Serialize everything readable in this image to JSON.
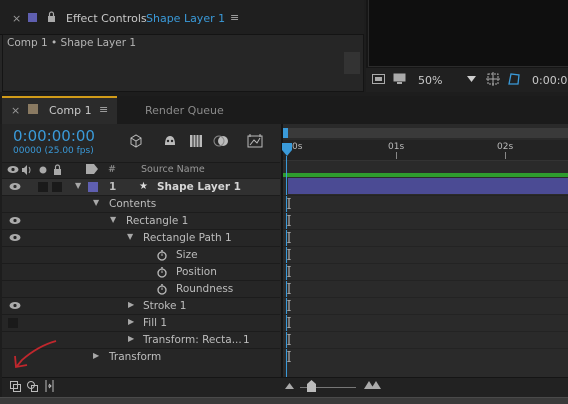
{
  "effect_controls": {
    "close": "×",
    "title": "Effect Controls",
    "layer_name": "Shape Layer 1",
    "menu": "≡",
    "breadcrumb": "Comp 1 • Shape Layer 1"
  },
  "viewer": {
    "zoom": "50%",
    "timecode": "0:00:00:"
  },
  "comp_tabs": {
    "close": "×",
    "active_label": "Comp 1",
    "menu": "≡",
    "inactive_label": "Render Queue"
  },
  "comp": {
    "timecode": "0:00:00:00",
    "frame_info": "00000 (25.00 fps)",
    "col_hash": "#",
    "col_source": "Source Name"
  },
  "ruler": {
    "ticks": [
      "0s",
      "01s",
      "02s"
    ]
  },
  "layers": [
    {
      "num": "1",
      "star": "★",
      "name": "Shape Layer 1"
    },
    {
      "name": "Contents"
    },
    {
      "name": "Rectangle 1"
    },
    {
      "name": "Rectangle Path 1"
    },
    {
      "name": "Size"
    },
    {
      "name": "Position"
    },
    {
      "name": "Roundness"
    },
    {
      "name": "Stroke 1"
    },
    {
      "name": "Fill 1"
    },
    {
      "name": "Transform: Recta...",
      "num": "1"
    },
    {
      "name": "Transform"
    }
  ],
  "colors": {
    "accent": "#3a9ad9",
    "label_purple": "#5f5fb0",
    "tab_active_line": "#d19b19",
    "layer_bar": "#4b4b94",
    "work_area": "#2e9c2e",
    "annotation": "#c0272d"
  }
}
